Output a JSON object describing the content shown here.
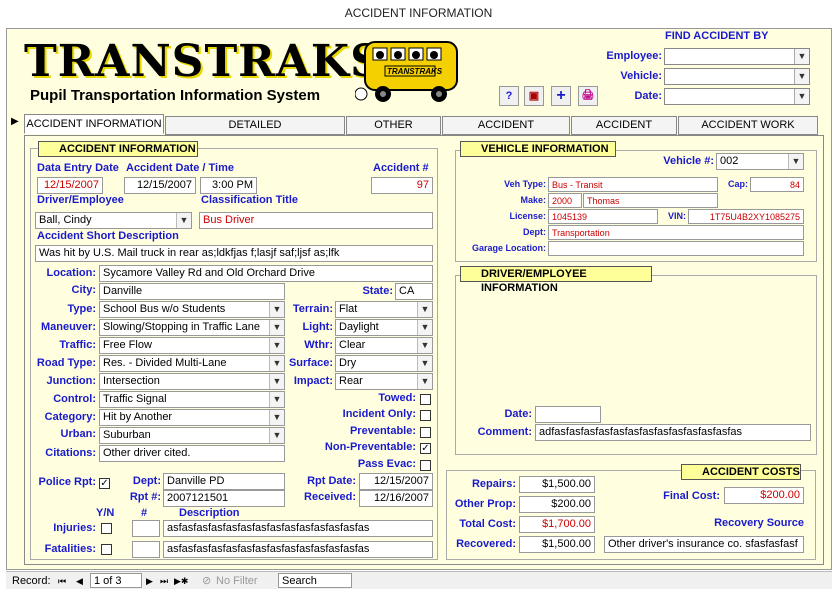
{
  "window": {
    "title": "ACCIDENT INFORMATION"
  },
  "header": {
    "logo": "TRANSTRAKS",
    "tagline": "Pupil Transportation Information System",
    "bus_label": "TRANSTRAKS",
    "toolbar": {
      "help": "?",
      "close": "▣",
      "add": "+",
      "print": "🖨"
    }
  },
  "find": {
    "title": "FIND ACCIDENT BY",
    "employee_label": "Employee:",
    "vehicle_label": "Vehicle:",
    "date_label": "Date:",
    "employee_value": "",
    "vehicle_value": "",
    "date_value": ""
  },
  "tabs": [
    {
      "label": "ACCIDENT INFORMATION",
      "active": true
    },
    {
      "label": "DETAILED COMMENTS/WITNESSES"
    },
    {
      "label": "OTHER VEHICLES"
    },
    {
      "label": "ACCIDENT PASSENGERS"
    },
    {
      "label": "ACCIDENT PHOTOS"
    },
    {
      "label": "ACCIDENT WORK ORDERS"
    }
  ],
  "accident": {
    "section_title": "ACCIDENT INFORMATION",
    "data_entry_date_label": "Data Entry Date",
    "data_entry_date": "12/15/2007",
    "accident_date_label": "Accident Date / Time",
    "accident_date": "12/15/2007",
    "accident_time": "3:00 PM",
    "accident_num_label": "Accident #",
    "accident_num": "97",
    "driver_label": "Driver/Employee",
    "driver": "Ball, Cindy",
    "classification_label": "Classification Title",
    "classification": "Bus Driver",
    "short_desc_label": "Accident Short Description",
    "short_desc": "Was hit by U.S. Mail truck in rear as;ldkfjas f;lasjf saf;ljsf as;lfk",
    "location_label": "Location:",
    "location": "Sycamore Valley Rd and Old Orchard Drive",
    "city_label": "City:",
    "city": "Danville",
    "state_label": "State:",
    "state": "CA",
    "type_label": "Type:",
    "type": "School Bus w/o Students",
    "maneuver_label": "Maneuver:",
    "maneuver": "Slowing/Stopping in Traffic Lane",
    "traffic_label": "Traffic:",
    "traffic": "Free Flow",
    "road_type_label": "Road Type:",
    "road_type": "Res. - Divided Multi-Lane",
    "junction_label": "Junction:",
    "junction": "Intersection",
    "control_label": "Control:",
    "control": "Traffic Signal",
    "category_label": "Category:",
    "category": "Hit by Another",
    "urban_label": "Urban:",
    "urban": "Suburban",
    "citations_label": "Citations:",
    "citations": "Other driver cited.",
    "terrain_label": "Terrain:",
    "terrain": "Flat",
    "light_label": "Light:",
    "light": "Daylight",
    "wthr_label": "Wthr:",
    "wthr": "Clear",
    "surface_label": "Surface:",
    "surface": "Dry",
    "impact_label": "Impact:",
    "impact": "Rear",
    "towed_label": "Towed:",
    "towed": "",
    "incident_only_label": "Incident Only:",
    "incident_only": "",
    "preventable_label": "Preventable:",
    "preventable": "",
    "non_preventable_label": "Non-Preventable:",
    "non_preventable": "✓",
    "pass_evac_label": "Pass Evac:",
    "pass_evac": "",
    "police_rpt_label": "Police Rpt:",
    "police_rpt": "✓",
    "dept_label": "Dept:",
    "dept": "Danville PD",
    "rpt_num_label": "Rpt #:",
    "rpt_num": "2007121501",
    "rpt_date_label": "Rpt Date:",
    "rpt_date": "12/15/2007",
    "received_label": "Received:",
    "received": "12/16/2007",
    "yn_header": "Y/N",
    "num_header": "#",
    "desc_header": "Description",
    "injuries_label": "Injuries:",
    "injuries_num": "",
    "injuries_desc": "asfasfasfasfasfasfasfasfasfasfasfasfasfas",
    "fatalities_label": "Fatalities:",
    "fatalities_num": "",
    "fatalities_desc": "asfasfasfasfasfasfasfasfasfasfasfasfasfas"
  },
  "vehicle": {
    "section_title": "VEHICLE INFORMATION",
    "vehicle_num_label": "Vehicle #:",
    "vehicle_num": "002",
    "veh_type_label": "Veh Type:",
    "veh_type": "Bus - Transit",
    "cap_label": "Cap:",
    "cap": "84",
    "make_label": "Make:",
    "make_year": "2000",
    "make": "Thomas",
    "license_label": "License:",
    "license": "1045139",
    "vin_label": "VIN:",
    "vin": "1T75U4B2XY1085275",
    "dept_label": "Dept:",
    "dept": "Transportation",
    "garage_label": "Garage Location:",
    "garage": ""
  },
  "driver_info": {
    "section_title": "DRIVER/EMPLOYEE INFORMATION",
    "date_label": "Date:",
    "date": "",
    "comment_label": "Comment:",
    "comment": "adfasfasfasfasfasfasfasfasfasfasfasfasfas"
  },
  "costs": {
    "section_title": "ACCIDENT COSTS",
    "repairs_label": "Repairs:",
    "repairs": "$1,500.00",
    "other_prop_label": "Other Prop:",
    "other_prop": "$200.00",
    "total_cost_label": "Total Cost:",
    "total_cost": "$1,700.00",
    "recovered_label": "Recovered:",
    "recovered": "$1,500.00",
    "final_cost_label": "Final Cost:",
    "final_cost": "$200.00",
    "recovery_source_label": "Recovery Source",
    "recovery_source": "Other driver's insurance co. sfasfasfasf"
  },
  "statusbar": {
    "record_label": "Record:",
    "first": "⏮",
    "prev": "◀",
    "position": "1 of 3",
    "next": "▶",
    "last": "⏭",
    "new": "▶✱",
    "filter": "No Filter",
    "search": "Search"
  }
}
